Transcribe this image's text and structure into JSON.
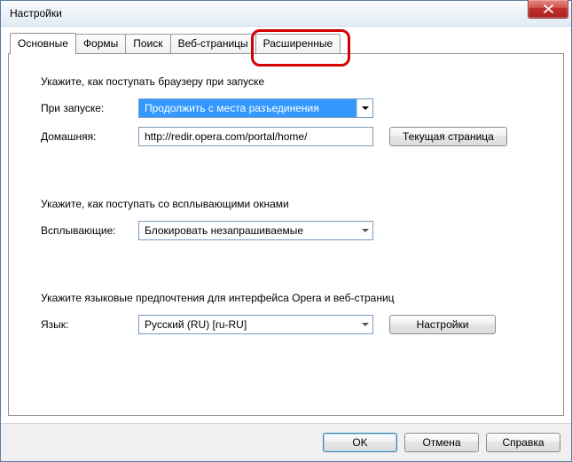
{
  "window": {
    "title": "Настройки"
  },
  "tabs": {
    "items": [
      {
        "label": "Основные"
      },
      {
        "label": "Формы"
      },
      {
        "label": "Поиск"
      },
      {
        "label": "Веб-страницы"
      },
      {
        "label": "Расширенные"
      }
    ]
  },
  "startup": {
    "heading": "Укажите, как поступать браузеру при запуске",
    "on_start_label": "При запуске:",
    "on_start_value": "Продолжить с места разъединения",
    "home_label": "Домашняя:",
    "home_value": "http://redir.opera.com/portal/home/",
    "current_page_btn": "Текущая страница"
  },
  "popups": {
    "heading": "Укажите, как поступать со всплывающими окнами",
    "label": "Всплывающие:",
    "value": "Блокировать незапрашиваемые"
  },
  "language": {
    "heading": "Укажите языковые предпочтения для интерфейса Opera и веб-страниц",
    "label": "Язык:",
    "value": "Русский (RU) [ru-RU]",
    "settings_btn": "Настройки"
  },
  "footer": {
    "ok": "OK",
    "cancel": "Отмена",
    "help": "Справка"
  }
}
